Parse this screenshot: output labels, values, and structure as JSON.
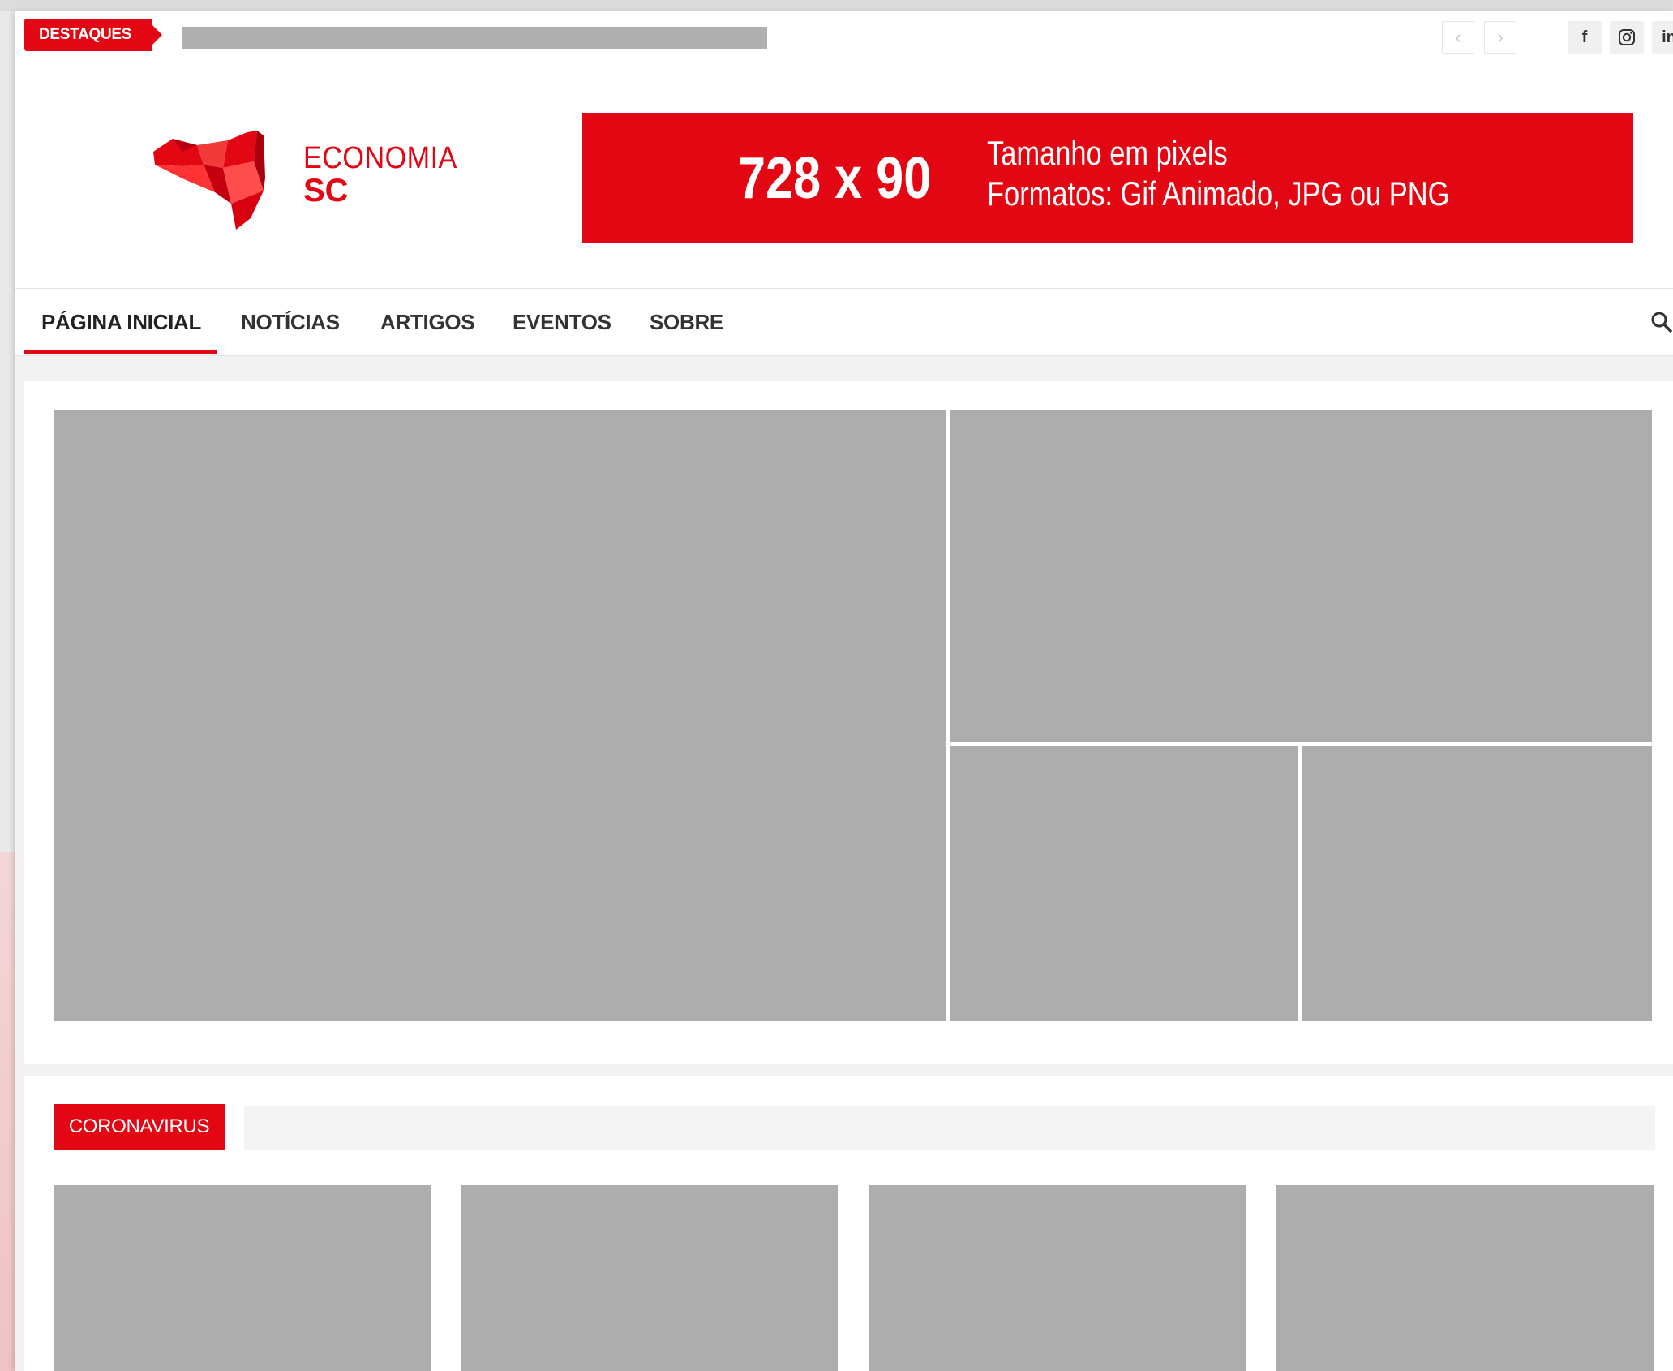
{
  "topbar": {
    "highlights_label": "DESTAQUES",
    "prev_glyph": "‹",
    "next_glyph": "›",
    "social": [
      {
        "icon": "facebook-icon",
        "glyph": "f"
      },
      {
        "icon": "instagram-icon",
        "glyph": ""
      },
      {
        "icon": "linkedin-icon",
        "glyph": "in"
      }
    ]
  },
  "header": {
    "logo_line1": "ECONOMIA",
    "logo_line2": "SC",
    "ad": {
      "size": "728 x 90",
      "line1": "Tamanho em pixels",
      "line2": "Formatos: Gif Animado, JPG ou PNG"
    }
  },
  "nav": {
    "items": [
      {
        "label": "PÁGINA INICIAL",
        "active": true
      },
      {
        "label": "NOTÍCIAS"
      },
      {
        "label": "ARTIGOS"
      },
      {
        "label": "EVENTOS"
      },
      {
        "label": "SOBRE"
      }
    ]
  },
  "sections": {
    "coronavirus_label": "CORONAVIRUS"
  },
  "colors": {
    "brand_red": "#e30613",
    "placeholder_gray": "#acadac"
  }
}
